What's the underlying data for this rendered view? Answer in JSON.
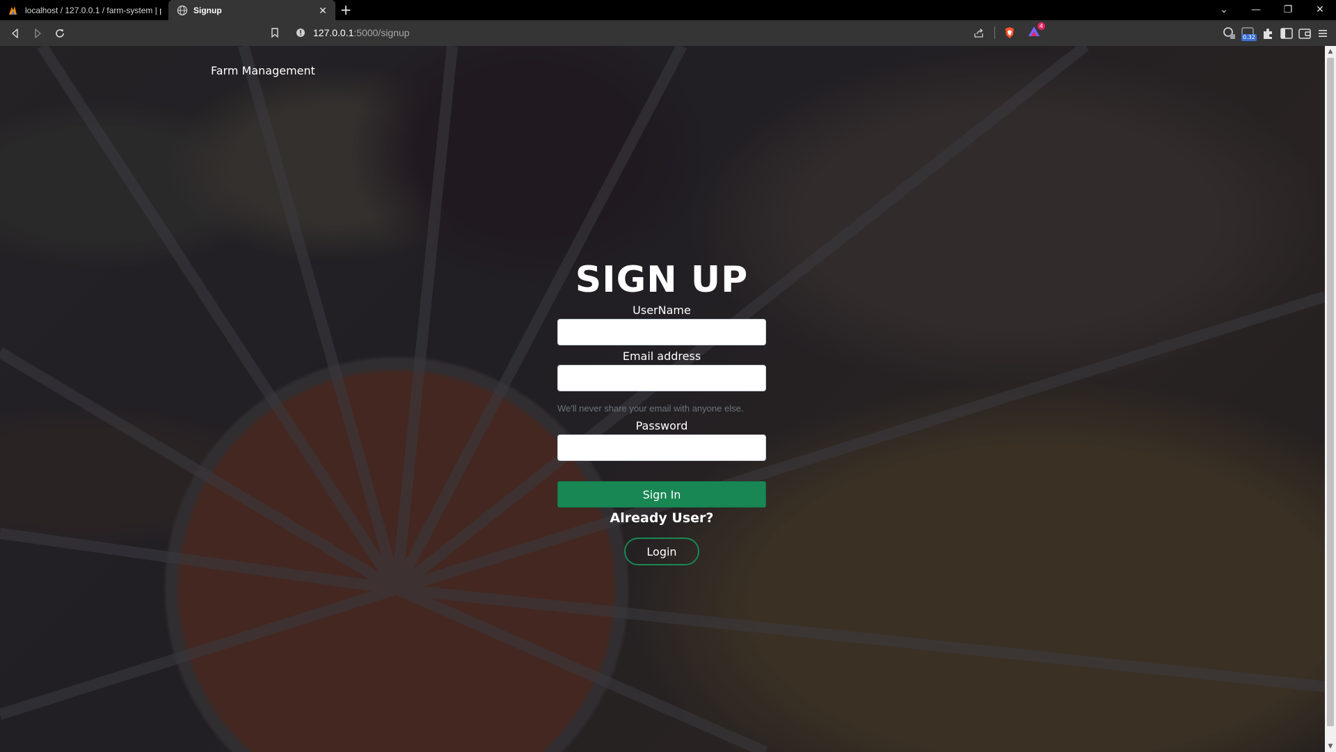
{
  "browser": {
    "tabs": [
      {
        "title": "localhost / 127.0.0.1 / farm-system | p",
        "active": false
      },
      {
        "title": "Signup",
        "active": true
      }
    ],
    "new_tab_symbol": "+",
    "address": {
      "host": "127.0.0.1",
      "path": ":5000/signup"
    },
    "shield_badge": "4",
    "extension_badge": "0.32"
  },
  "page": {
    "brand": "Farm Management",
    "heading": "SIGN UP",
    "fields": {
      "username_label": "UserName",
      "email_label": "Email address",
      "email_help": "We'll never share your email with anyone else.",
      "password_label": "Password"
    },
    "signin_label": "Sign In",
    "already_text": "Already User?",
    "login_label": "Login"
  },
  "colors": {
    "primary": "#198754",
    "overlay": "#14121e"
  }
}
